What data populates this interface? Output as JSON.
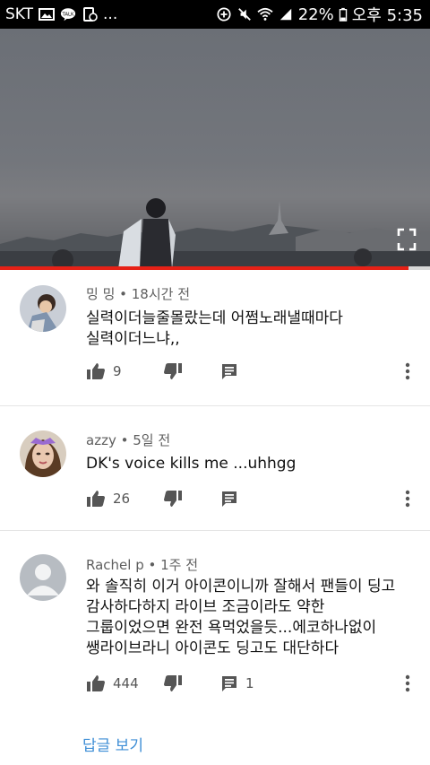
{
  "status_bar": {
    "carrier": "SKT",
    "more": "...",
    "battery": "22%",
    "time": "오후 5:35",
    "icons": [
      "image-icon",
      "talk-icon",
      "screen-record-icon",
      "data-saver-icon",
      "mute-icon",
      "wifi-icon",
      "signal-icon",
      "battery-icon"
    ]
  },
  "video": {
    "progress": 0.95
  },
  "comments": [
    {
      "author": "밍 밍",
      "time": "18시간 전",
      "body_lines": [
        "실력이더늘줄몰랐는데 어쩜노래낼때마다",
        "실력이더느냐,,"
      ],
      "likes": "9",
      "replies": ""
    },
    {
      "author": "azzy",
      "time": "5일 전",
      "body_lines": [
        "DK's voice kills me ...uhhgg"
      ],
      "likes": "26",
      "replies": ""
    },
    {
      "author": "Rachel p",
      "time": "1주 전",
      "body_lines": [
        "와 솔직히 이거 아이콘이니까 잘해서 팬들이 딩고",
        "감사하다하지 라이브 조금이라도 약한",
        "그룹이었으면 완전 욕먹었을듯...에코하나없이",
        "쌩라이브라니 아이콘도 딩고도 대단하다"
      ],
      "likes": "444",
      "replies": "1"
    }
  ],
  "view_replies": "답글 보기",
  "colors": {
    "accent": "#e62117",
    "link": "#3e8ed6",
    "icon": "#555555"
  }
}
